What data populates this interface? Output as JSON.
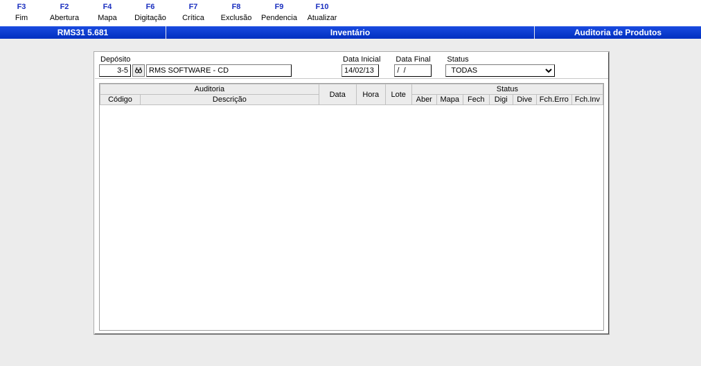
{
  "fkeys": [
    {
      "code": "F3",
      "label": "Fim"
    },
    {
      "code": "F2",
      "label": "Abertura"
    },
    {
      "code": "F4",
      "label": "Mapa"
    },
    {
      "code": "F6",
      "label": "Digitação"
    },
    {
      "code": "F7",
      "label": "Crítica"
    },
    {
      "code": "F8",
      "label": "Exclusão"
    },
    {
      "code": "F9",
      "label": "Pendencia"
    },
    {
      "code": "F10",
      "label": "Atualizar"
    }
  ],
  "header": {
    "left": "RMS31 5.681",
    "center": "Inventário",
    "right": "Auditoria de Produtos"
  },
  "filters": {
    "deposito_label": "Depósito",
    "deposito_code": "3-5",
    "deposito_desc": "RMS SOFTWARE - CD",
    "data_inicial_label": "Data Inicial",
    "data_inicial": "14/02/13",
    "data_final_label": "Data Final",
    "data_final": "/  /",
    "status_label": "Status",
    "status_value": "TODAS"
  },
  "grid": {
    "group_auditoria": "Auditoria",
    "group_status": "Status",
    "col_codigo": "Código",
    "col_descricao": "Descrição",
    "col_data": "Data",
    "col_hora": "Hora",
    "col_lote": "Lote",
    "col_aber": "Aber",
    "col_mapa": "Mapa",
    "col_fech": "Fech",
    "col_digi": "Digi",
    "col_dive": "Dive",
    "col_fcherro": "Fch.Erro",
    "col_fchinv": "Fch.Inv"
  }
}
